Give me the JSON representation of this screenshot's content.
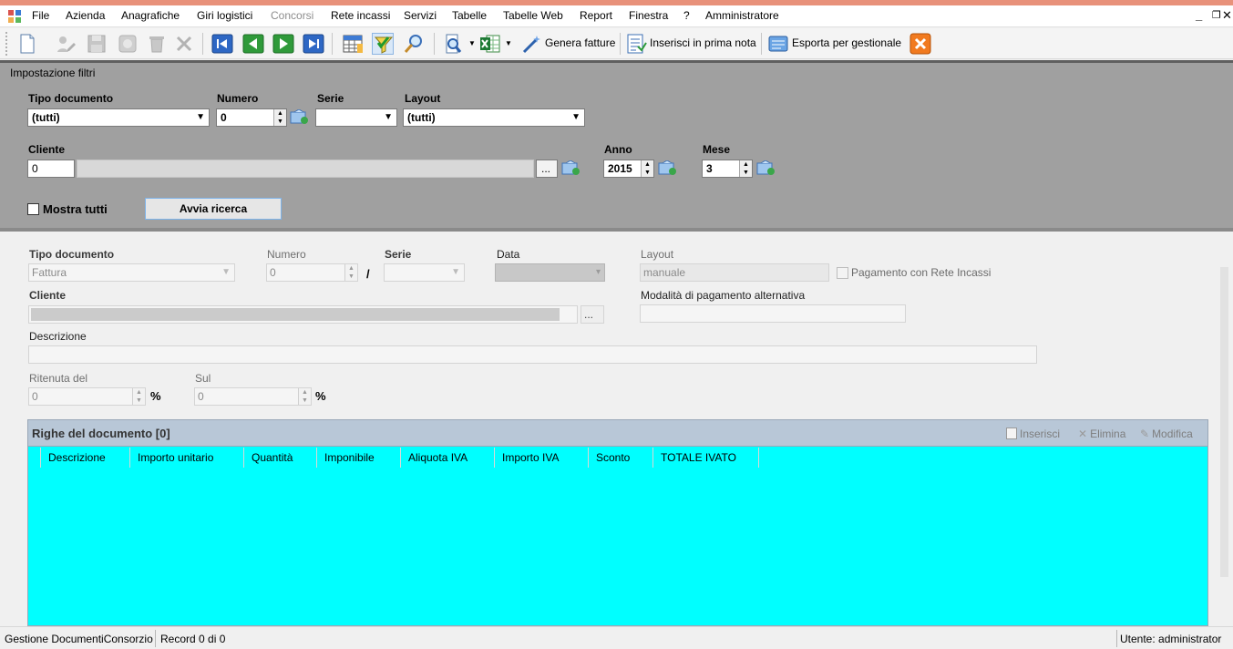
{
  "menu": {
    "items": [
      "File",
      "Azienda",
      "Anagrafiche",
      "Giri logistici",
      "Concorsi",
      "Rete incassi",
      "Servizi",
      "Tabelle",
      "Tabelle Web",
      "Report",
      "Finestra",
      "?",
      "Amministratore"
    ],
    "disabled": [
      "Concorsi"
    ]
  },
  "toolbar": {
    "genera_fatture": "Genera fatture",
    "inserisci_prima_nota": "Inserisci in prima nota",
    "esporta_gestionale": "Esporta per gestionale"
  },
  "filters": {
    "title": "Impostazione filtri",
    "tipo_documento_label": "Tipo documento",
    "tipo_documento_value": "(tutti)",
    "numero_label": "Numero",
    "numero_value": "0",
    "serie_label": "Serie",
    "serie_value": "",
    "layout_label": "Layout",
    "layout_value": "(tutti)",
    "cliente_label": "Cliente",
    "cliente_value": "0",
    "cliente_browse": "...",
    "anno_label": "Anno",
    "anno_value": "2015",
    "mese_label": "Mese",
    "mese_value": "3",
    "mostra_tutti_label": "Mostra tutti",
    "mostra_tutti_checked": false,
    "avvia_ricerca": "Avvia ricerca"
  },
  "detail": {
    "tipo_documento_label": "Tipo documento",
    "tipo_documento_value": "Fattura",
    "numero_label": "Numero",
    "numero_value": "0",
    "slash": "/",
    "serie_label": "Serie",
    "data_label": "Data",
    "layout_label": "Layout",
    "layout_value": "manuale",
    "pagamento_rete_label": "Pagamento con Rete Incassi",
    "cliente_label": "Cliente",
    "cliente_browse": "...",
    "modalita_label": "Modalità di pagamento alternativa",
    "descrizione_label": "Descrizione",
    "ritenuta_label": "Ritenuta del",
    "ritenuta_value": "0",
    "sul_label": "Sul",
    "sul_value": "0",
    "percent": "%"
  },
  "grid": {
    "title": "Righe del documento [0]",
    "inserisci": "Inserisci",
    "elimina": "Elimina",
    "modifica": "Modifica",
    "columns": [
      "Descrizione",
      "Importo unitario",
      "Quantità",
      "Imponibile",
      "Aliquota IVA",
      "Importo IVA",
      "Sconto",
      "TOTALE IVATO"
    ],
    "fill_color": "#00ffff"
  },
  "status": {
    "module": "Gestione DocumentiConsorzio",
    "record": "Record 0 di 0",
    "user": "Utente: administrator"
  }
}
